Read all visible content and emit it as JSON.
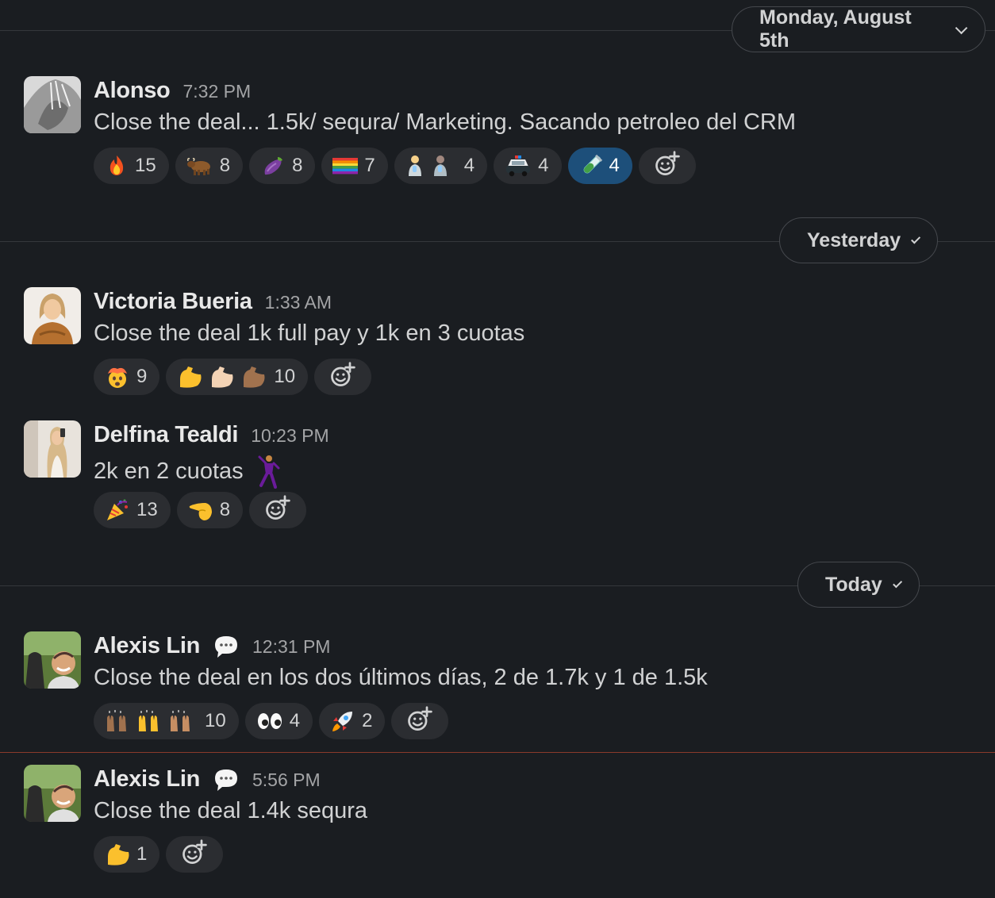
{
  "dividers": [
    {
      "label": "Monday, August 5th"
    },
    {
      "label": "Yesterday"
    },
    {
      "label": "Today"
    }
  ],
  "messages": [
    {
      "name": "Alonso",
      "time": "7:32 PM",
      "text": "Close the deal... 1.5k/ sequra/ Marketing. Sacando petroleo del CRM",
      "reactions": [
        {
          "emoji": "fire",
          "count": "15"
        },
        {
          "emoji": "ox",
          "count": "8"
        },
        {
          "emoji": "eggplant",
          "count": "8"
        },
        {
          "emoji": "rainbow-flag",
          "count": "7"
        },
        {
          "emoji": "baby-bottle-people",
          "count": "4"
        },
        {
          "emoji": "police-car",
          "count": "4"
        },
        {
          "emoji": "test-tube",
          "count": "4",
          "active": true
        }
      ]
    },
    {
      "name": "Victoria Bueria",
      "time": "1:33 AM",
      "text": "Close the deal 1k full pay y 1k en 3 cuotas",
      "reactions": [
        {
          "emoji": "exploding-head",
          "count": "9"
        },
        {
          "emoji": "flexed-biceps-skin-tones",
          "count": "10"
        }
      ]
    },
    {
      "name": "Delfina Tealdi",
      "time": "10:23 PM",
      "text": "2k en 2 cuotas",
      "inline_emoji": "dancing-man",
      "reactions": [
        {
          "emoji": "party-popper",
          "count": "13"
        },
        {
          "emoji": "saluting-hand",
          "count": "8"
        }
      ]
    },
    {
      "name": "Alexis Lin",
      "time": "12:31 PM",
      "status_icon": "speech-bubble",
      "text": "Close the deal en los dos últimos días, 2 de 1.7k y 1 de 1.5k",
      "reactions": [
        {
          "emoji": "raising-hands-skin-tones",
          "count": "10"
        },
        {
          "emoji": "eyes",
          "count": "4"
        },
        {
          "emoji": "rocket",
          "count": "2"
        }
      ]
    },
    {
      "name": "Alexis Lin",
      "time": "5:56 PM",
      "status_icon": "speech-bubble",
      "text": "Close the deal 1.4k sequra",
      "reactions": [
        {
          "emoji": "flexed-biceps",
          "count": "1"
        }
      ]
    }
  ],
  "colors": {
    "background": "#1a1d21",
    "reaction_bg": "#2b2d31",
    "reaction_active_bg": "#1d4f7a",
    "divider": "#35373b",
    "new_messages_line": "#8b3a2b"
  }
}
